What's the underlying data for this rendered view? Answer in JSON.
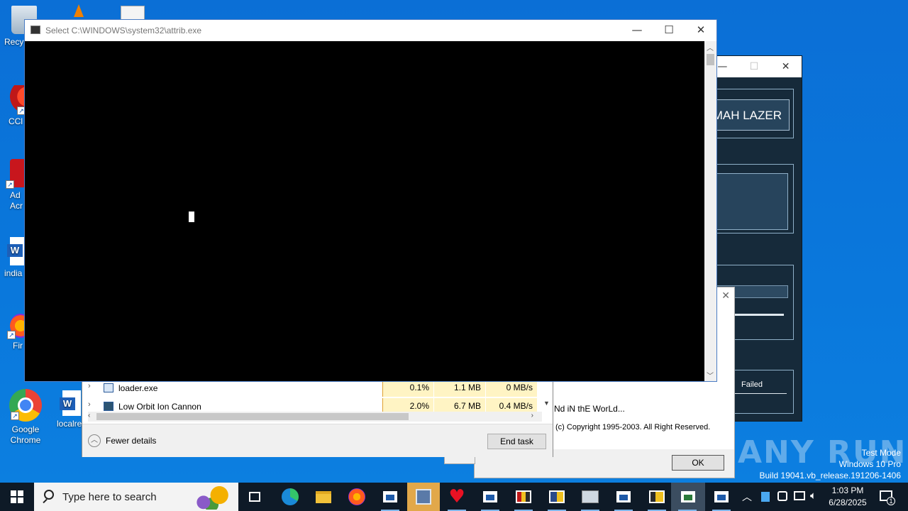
{
  "desktop": {
    "icons": [
      {
        "label": "Recy",
        "name": "recycle-bin"
      },
      {
        "label": "CCl",
        "name": "ccleaner"
      },
      {
        "label": "Ad\nAcr",
        "name": "adobe-acrobat"
      },
      {
        "label": "india",
        "name": "word-doc-india"
      },
      {
        "label": "Fir",
        "name": "firefox"
      },
      {
        "label": "Google\nChrome",
        "name": "google-chrome"
      },
      {
        "label": "localre",
        "name": "word-doc-localre"
      }
    ],
    "watermark": {
      "line1": "Test Mode",
      "line2": "Windows 10 Pro",
      "line3": "Build 19041.vb_release.191206-1406"
    },
    "anyrun_logo": "ANY RUN"
  },
  "console": {
    "title": "Select C:\\WINDOWS\\system32\\attrib.exe",
    "minimize": "—",
    "maximize": "☐",
    "close": "✕"
  },
  "loic": {
    "button_label": "IMMA CHARGIN MAH LAZER",
    "status": "Failed",
    "close": "✕",
    "maximize": "☐",
    "minimize": "—"
  },
  "task_manager": {
    "rows": [
      {
        "name": "loader.exe",
        "cpu": "0.1%",
        "memory": "1.1 MB",
        "disk": "0 MB/s"
      },
      {
        "name": "Low Orbit Ion Cannon",
        "cpu": "2.0%",
        "memory": "6.7 MB",
        "disk": "0.4 MB/s"
      }
    ],
    "fewer_details": "Fewer details",
    "end_task": "End task"
  },
  "about_dialog": {
    "line1": "Nd iN thE WorLd...",
    "line2": "(c) Copyright 1995-2003. All Right Reserved.",
    "ok": "OK",
    "close": "✕"
  },
  "taskbar": {
    "search_placeholder": "Type here to search",
    "time": "1:03 PM",
    "date": "6/28/2025",
    "notification_count": "1"
  }
}
